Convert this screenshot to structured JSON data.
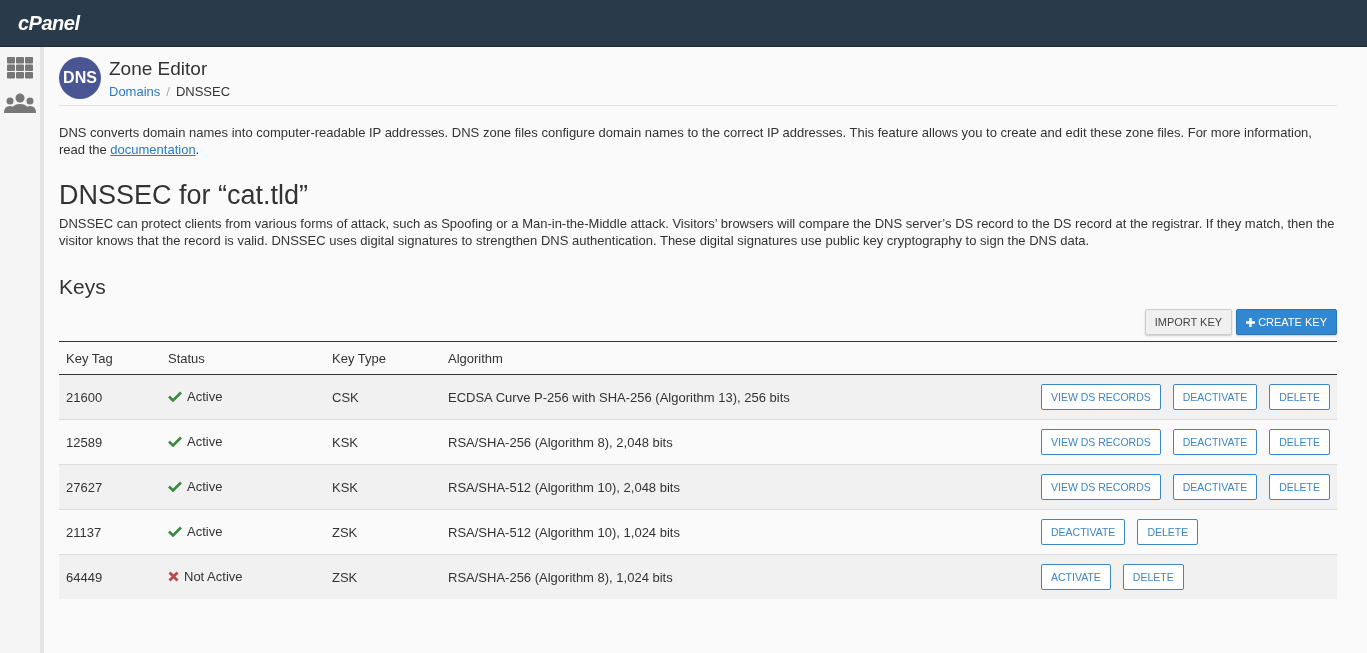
{
  "top_bar": {
    "logo": "cPanel"
  },
  "header": {
    "icon_text": "DNS",
    "title": "Zone Editor",
    "breadcrumb_separator": "/",
    "breadcrumbs": [
      {
        "label": "Domains",
        "link": true
      },
      {
        "label": "DNSSEC",
        "link": false
      }
    ]
  },
  "intro": {
    "before": "DNS converts domain names into computer-readable IP addresses. DNS zone files configure domain names to the correct IP addresses. This feature allows you to create and edit these zone files. For more information, read the ",
    "link": "documentation",
    "after": "."
  },
  "heading": "DNSSEC for “cat.tld”",
  "description": "DNSSEC can protect clients from various forms of attack, such as Spoofing or a Man-in-the-Middle attack. Visitors’ browsers will compare the DNS server’s DS record to the DS record at the registrar. If they match, then the visitor knows that the record is valid. DNSSEC uses digital signatures to strengthen DNS authentication. These digital signatures use public key cryptography to sign the DNS data.",
  "keys_heading": "Keys",
  "toolbar": [
    {
      "label": "IMPORT KEY",
      "kind": "default"
    },
    {
      "label": "CREATE KEY",
      "kind": "primary"
    }
  ],
  "table": {
    "columns": [
      "Key Tag",
      "Status",
      "Key Type",
      "Algorithm"
    ],
    "rows": [
      {
        "key_tag": "21600",
        "active": true,
        "status": "Active",
        "key_type": "CSK",
        "algorithm": "ECDSA Curve P-256 with SHA-256 (Algorithm 13), 256 bits",
        "actions": [
          "VIEW DS RECORDS",
          "DEACTIVATE",
          "DELETE"
        ]
      },
      {
        "key_tag": "12589",
        "active": true,
        "status": "Active",
        "key_type": "KSK",
        "algorithm": "RSA/SHA-256 (Algorithm 8), 2,048 bits",
        "actions": [
          "VIEW DS RECORDS",
          "DEACTIVATE",
          "DELETE"
        ]
      },
      {
        "key_tag": "27627",
        "active": true,
        "status": "Active",
        "key_type": "KSK",
        "algorithm": "RSA/SHA-512 (Algorithm 10), 2,048 bits",
        "actions": [
          "VIEW DS RECORDS",
          "DEACTIVATE",
          "DELETE"
        ]
      },
      {
        "key_tag": "21137",
        "active": true,
        "status": "Active",
        "key_type": "ZSK",
        "algorithm": "RSA/SHA-512 (Algorithm 10), 1,024 bits",
        "actions": [
          "DEACTIVATE",
          "DELETE"
        ]
      },
      {
        "key_tag": "64449",
        "active": false,
        "status": "Not Active",
        "key_type": "ZSK",
        "algorithm": "RSA/SHA-256 (Algorithm 8), 1,024 bits",
        "actions": [
          "ACTIVATE",
          "DELETE"
        ]
      }
    ]
  }
}
